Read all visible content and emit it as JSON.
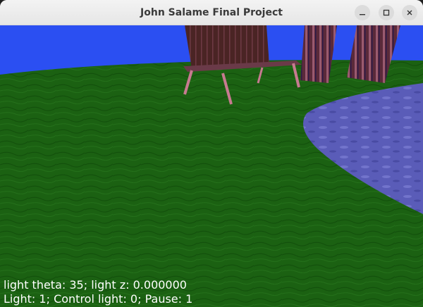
{
  "window": {
    "title": "John Salame Final Project",
    "controls": {
      "minimize_icon": "minimize-icon",
      "maximize_icon": "maximize-icon",
      "close_icon": "close-icon"
    }
  },
  "scene": {
    "colors": {
      "sky": "#2b4ff2",
      "grass": "#1b6112",
      "grass_dark": "#0f4a0a",
      "water": "#5a5cb8",
      "water_light": "#8a8ce0",
      "wood": "#4a2424",
      "wood_stripe": "#8a4a5a",
      "leg": "#c77a90"
    }
  },
  "hud": {
    "line1": "light theta: 35; light z: 0.000000",
    "line2": "Light: 1; Control light: 0; Pause: 1"
  }
}
